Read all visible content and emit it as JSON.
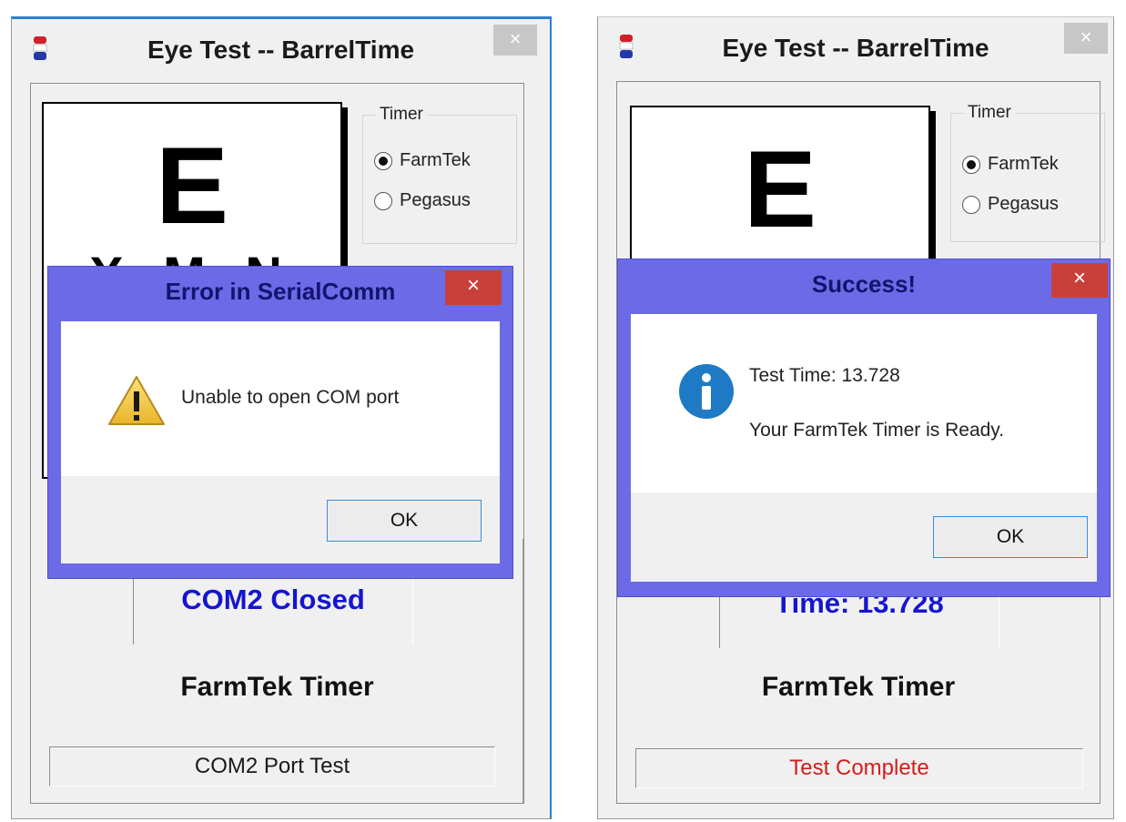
{
  "left": {
    "window_title": "Eye Test -- BarrelTime",
    "close_glyph": "×",
    "chart": {
      "big_letter": "E",
      "row_letters": "X M N"
    },
    "timer_group": {
      "label": "Timer",
      "options": [
        {
          "label": "FarmTek",
          "selected": true
        },
        {
          "label": "Pegasus",
          "selected": false
        }
      ]
    },
    "status_text": "COM2 Closed",
    "timer_name": "FarmTek Timer",
    "bottom_status": "COM2 Port Test",
    "bottom_status_color": "#1a1a1a",
    "dialog": {
      "title": "Error in SerialComm",
      "close_glyph": "×",
      "icon": "warning-icon",
      "message": "Unable to open COM port",
      "ok_label": "OK"
    }
  },
  "right": {
    "window_title": "Eye Test -- BarrelTime",
    "close_glyph": "×",
    "chart": {
      "big_letter": "E"
    },
    "timer_group": {
      "label": "Timer",
      "options": [
        {
          "label": "FarmTek",
          "selected": true
        },
        {
          "label": "Pegasus",
          "selected": false
        }
      ]
    },
    "status_text": "Time:  13.728",
    "timer_name": "FarmTek Timer",
    "bottom_status": "Test Complete",
    "bottom_status_color": "#d41c1c",
    "dialog": {
      "title": "Success!",
      "close_glyph": "×",
      "icon": "info-icon",
      "message_line1": "Test Time:  13.728",
      "message_line2": "Your FarmTek Timer is Ready.",
      "ok_label": "OK"
    }
  },
  "colors": {
    "dialog_frame": "#6b6be8",
    "status_text": "#1515d0",
    "dialog_close": "#c9403b",
    "info_icon": "#1e7ac4"
  }
}
